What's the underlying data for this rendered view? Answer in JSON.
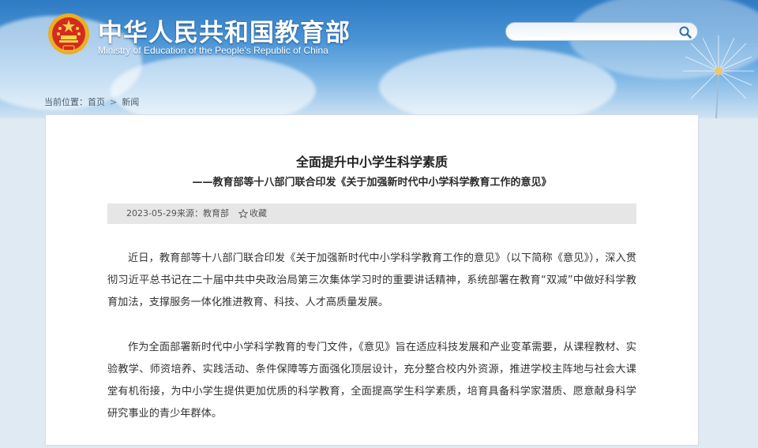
{
  "header": {
    "title": "中华人民共和国教育部",
    "subtitle": "Ministry of Education of the People's Republic of China",
    "search": {
      "value": "",
      "placeholder": ""
    }
  },
  "breadcrumb": {
    "label": "当前位置：",
    "home": "首页",
    "separator": ">",
    "current": "新闻"
  },
  "article": {
    "title": "全面提升中小学生科学素质",
    "subtitle": "——教育部等十八部门联合印发《关于加强新时代中小学科学教育工作的意见》",
    "meta": {
      "date": "2023-05-29",
      "source": "来源：教育部",
      "favorite": "收藏"
    },
    "paragraphs": [
      "近日，教育部等十八部门联合印发《关于加强新时代中小学科学教育工作的意见》（以下简称《意见》），深入贯彻习近平总书记在二十届中共中央政治局第三次集体学习时的重要讲话精神，系统部署在教育“双减”中做好科学教育加法，支撑服务一体化推进教育、科技、人才高质量发展。",
      "作为全面部署新时代中小学科学教育的专门文件，《意见》旨在适应科技发展和产业变革需要，从课程教材、实验教学、师资培养、实践活动、条件保障等方面强化顶层设计，充分整合校内外资源，推进学校主阵地与社会大课堂有机衔接，为中小学生提供更加优质的科学教育，全面提高学生科学素质，培育具备科学家潜质、愿意献身科学研究事业的青少年群体。"
    ]
  },
  "icons": {
    "emblem": "national-emblem",
    "search": "search-icon",
    "favorite": "star-icon"
  },
  "colors": {
    "header_blue": "#2f7bc4",
    "meta_bar": "#e6e6e6",
    "text": "#333333"
  }
}
